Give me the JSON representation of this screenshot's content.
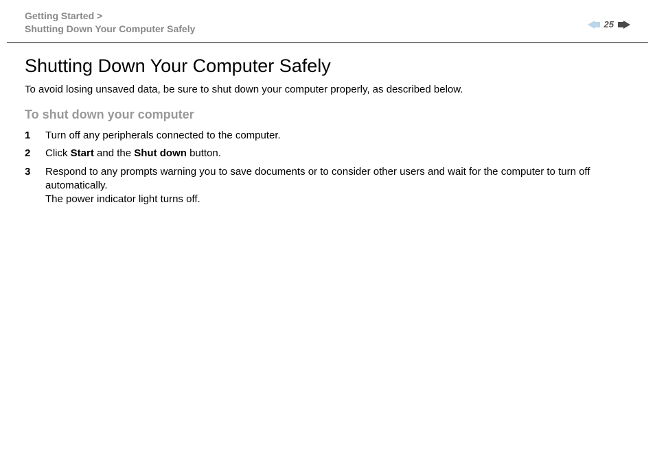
{
  "header": {
    "breadcrumb_line1": "Getting Started >",
    "breadcrumb_line2": "Shutting Down Your Computer Safely",
    "page_number": "25"
  },
  "content": {
    "title": "Shutting Down Your Computer Safely",
    "intro": "To avoid losing unsaved data, be sure to shut down your computer properly, as described below.",
    "subheading": "To shut down your computer",
    "steps": [
      {
        "num": "1",
        "parts": [
          {
            "text": "Turn off any peripherals connected to the computer.",
            "bold": false
          }
        ]
      },
      {
        "num": "2",
        "parts": [
          {
            "text": "Click ",
            "bold": false
          },
          {
            "text": "Start",
            "bold": true
          },
          {
            "text": " and the ",
            "bold": false
          },
          {
            "text": "Shut down",
            "bold": true
          },
          {
            "text": " button.",
            "bold": false
          }
        ]
      },
      {
        "num": "3",
        "parts": [
          {
            "text": "Respond to any prompts warning you to save documents or to consider other users and wait for the computer to turn off automatically.",
            "bold": false
          },
          {
            "text": "\n",
            "bold": false
          },
          {
            "text": "The power indicator light turns off.",
            "bold": false
          }
        ]
      }
    ]
  }
}
